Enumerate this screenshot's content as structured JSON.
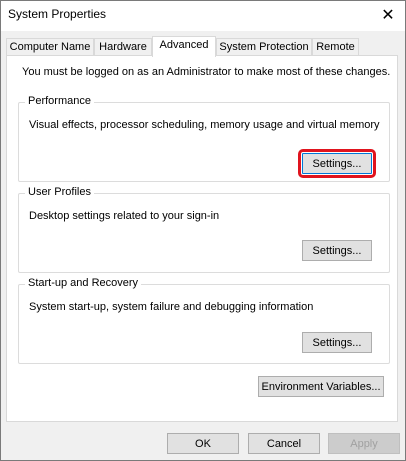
{
  "window": {
    "title": "System Properties",
    "close_glyph": "✕"
  },
  "tabs": [
    {
      "label": "Computer Name"
    },
    {
      "label": "Hardware"
    },
    {
      "label": "Advanced",
      "active": true
    },
    {
      "label": "System Protection"
    },
    {
      "label": "Remote"
    }
  ],
  "advanced": {
    "admin_note": "You must be logged on as an Administrator to make most of these changes.",
    "performance": {
      "title": "Performance",
      "description": "Visual effects, processor scheduling, memory usage and virtual memory",
      "button": "Settings..."
    },
    "user_profiles": {
      "title": "User Profiles",
      "description": "Desktop settings related to your sign-in",
      "button": "Settings..."
    },
    "startup_recovery": {
      "title": "Start-up and Recovery",
      "description": "System start-up, system failure and debugging information",
      "button": "Settings..."
    },
    "env_vars_button": "Environment Variables..."
  },
  "footer": {
    "ok": "OK",
    "cancel": "Cancel",
    "apply": "Apply"
  },
  "colors": {
    "highlight": "#e0141e",
    "focus_border": "#0078d7"
  }
}
